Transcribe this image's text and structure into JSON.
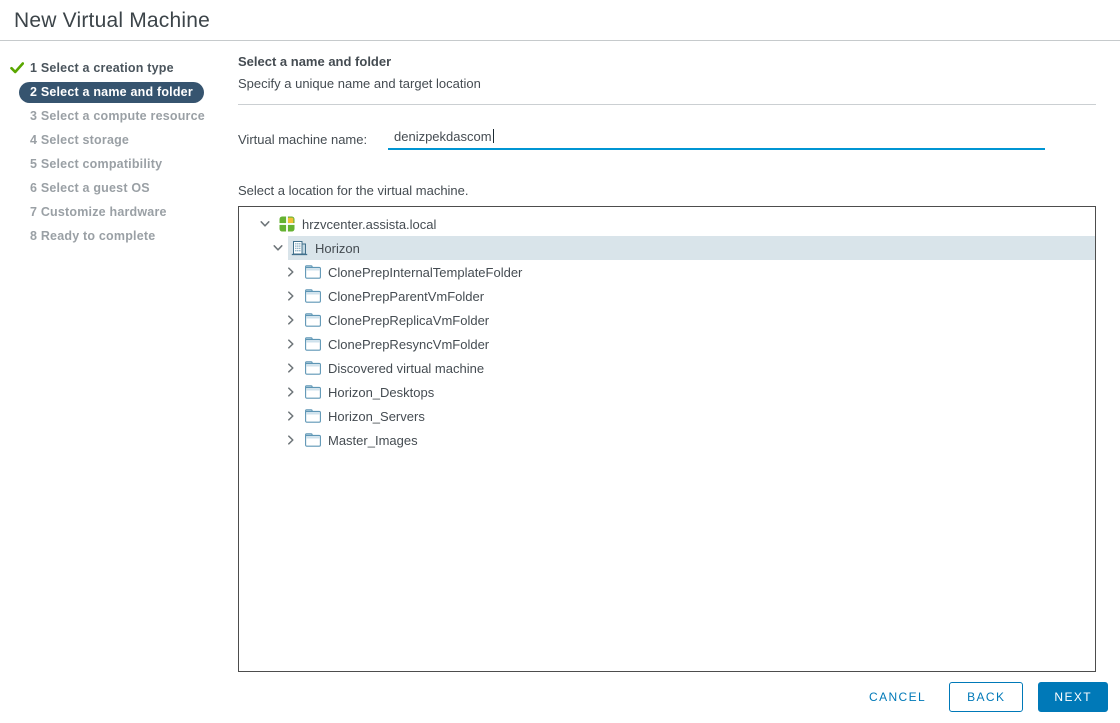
{
  "window": {
    "title": "New Virtual Machine"
  },
  "sidebar": {
    "steps": [
      {
        "num": "1",
        "label": "Select a creation type",
        "state": "done"
      },
      {
        "num": "2",
        "label": "Select a name and folder",
        "state": "active"
      },
      {
        "num": "3",
        "label": "Select a compute resource",
        "state": "pending"
      },
      {
        "num": "4",
        "label": "Select storage",
        "state": "pending"
      },
      {
        "num": "5",
        "label": "Select compatibility",
        "state": "pending"
      },
      {
        "num": "6",
        "label": "Select a guest OS",
        "state": "pending"
      },
      {
        "num": "7",
        "label": "Customize hardware",
        "state": "pending"
      },
      {
        "num": "8",
        "label": "Ready to complete",
        "state": "pending"
      }
    ]
  },
  "main": {
    "heading": "Select a name and folder",
    "subheading": "Specify a unique name and target location",
    "vm_name_label": "Virtual machine name:",
    "vm_name_value": "denizpekdascom",
    "location_label": "Select a location for the virtual machine.",
    "tree": {
      "rows": [
        {
          "label": "hrzvcenter.assista.local",
          "icon": "vcenter",
          "chevron": "down",
          "level": 0,
          "selected": false
        },
        {
          "label": "Horizon",
          "icon": "datacenter",
          "chevron": "down",
          "level": 1,
          "selected": true
        },
        {
          "label": "ClonePrepInternalTemplateFolder",
          "icon": "folder",
          "chevron": "right",
          "level": 2,
          "selected": false
        },
        {
          "label": "ClonePrepParentVmFolder",
          "icon": "folder",
          "chevron": "right",
          "level": 2,
          "selected": false
        },
        {
          "label": "ClonePrepReplicaVmFolder",
          "icon": "folder",
          "chevron": "right",
          "level": 2,
          "selected": false
        },
        {
          "label": "ClonePrepResyncVmFolder",
          "icon": "folder",
          "chevron": "right",
          "level": 2,
          "selected": false
        },
        {
          "label": "Discovered virtual machine",
          "icon": "folder",
          "chevron": "right",
          "level": 2,
          "selected": false
        },
        {
          "label": "Horizon_Desktops",
          "icon": "folder",
          "chevron": "right",
          "level": 2,
          "selected": false
        },
        {
          "label": "Horizon_Servers",
          "icon": "folder",
          "chevron": "right",
          "level": 2,
          "selected": false
        },
        {
          "label": "Master_Images",
          "icon": "folder",
          "chevron": "right",
          "level": 2,
          "selected": false
        }
      ]
    }
  },
  "footer": {
    "cancel": "CANCEL",
    "back": "BACK",
    "next": "NEXT"
  },
  "colors": {
    "primary": "#0079b8",
    "input_underline": "#0095d3",
    "active_step_bg": "#36546f",
    "selected_row_bg": "#d9e4ea",
    "check_green": "#5aa700",
    "vcenter_green": "#65b232",
    "vcenter_yellow": "#f2c037",
    "icon_blue": "#41708c",
    "folder_blue": "#5e96b5",
    "folder_fill": "#cfe2ec",
    "chevron_gray": "#6e7579"
  }
}
